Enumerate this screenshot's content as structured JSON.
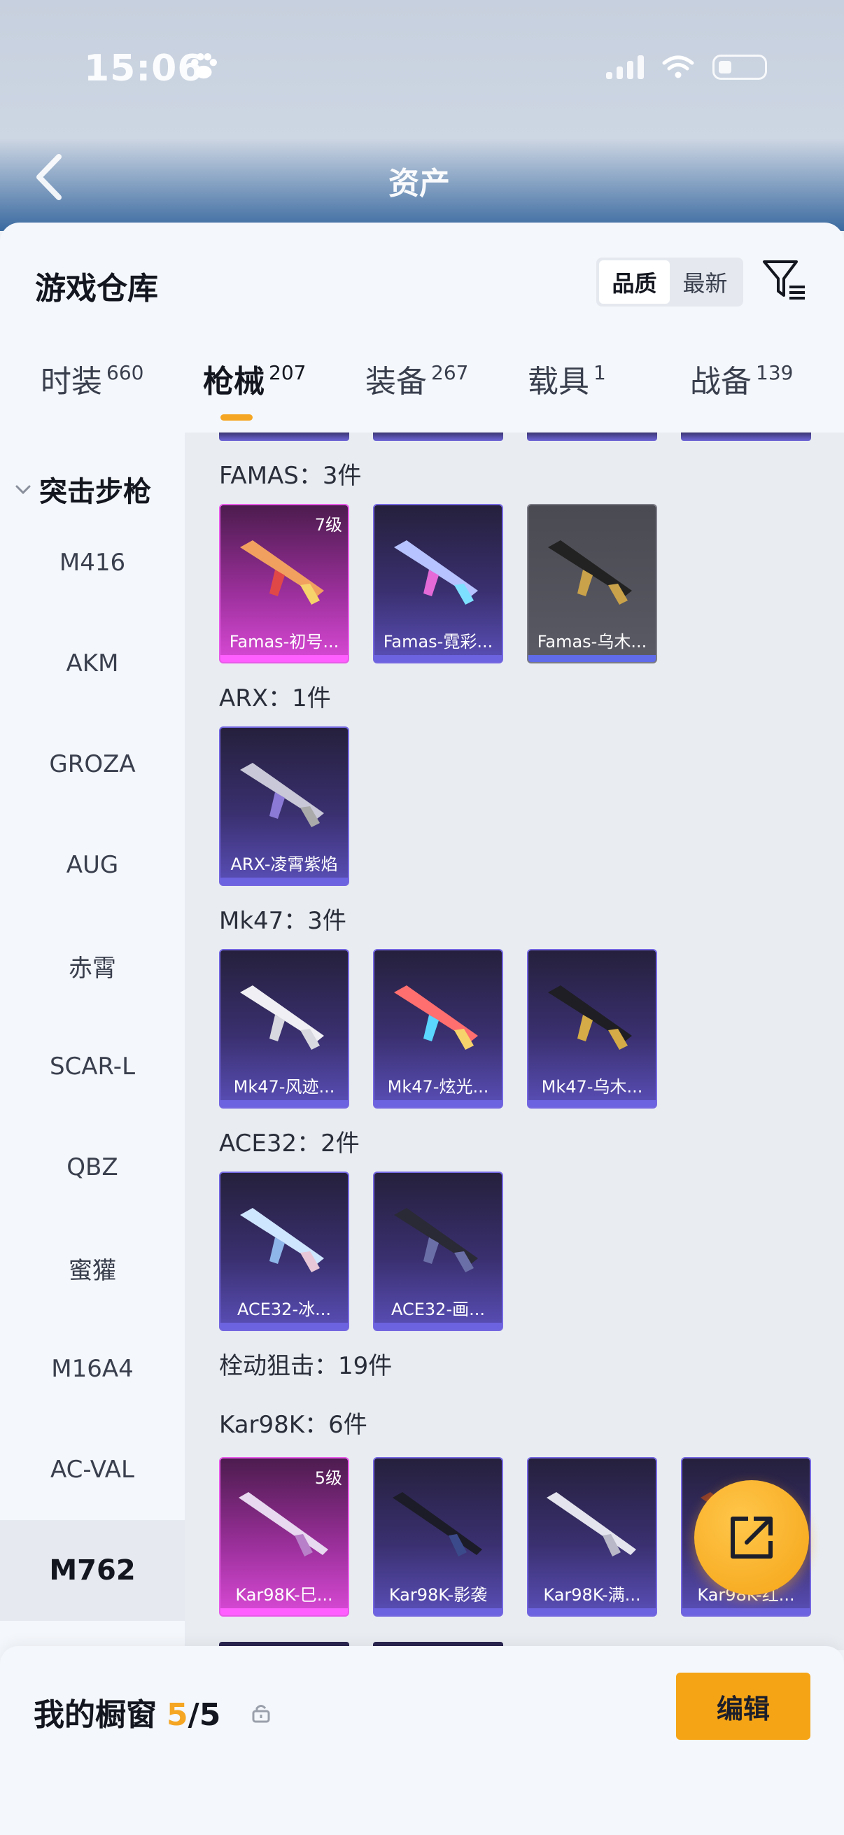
{
  "status_bar": {
    "time": "15:06"
  },
  "header": {
    "title": "资产"
  },
  "sheet": {
    "title": "游戏仓库",
    "sort": {
      "options": [
        "品质",
        "最新"
      ],
      "active": "品质"
    }
  },
  "tabs": [
    {
      "label": "时装",
      "count": "660"
    },
    {
      "label": "枪械",
      "count": "207"
    },
    {
      "label": "装备",
      "count": "267"
    },
    {
      "label": "载具",
      "count": "1"
    },
    {
      "label": "战备",
      "count": "139"
    }
  ],
  "sidebar": {
    "section": "突击步枪",
    "items": [
      "M416",
      "AKM",
      "GROZA",
      "AUG",
      "赤霄",
      "SCAR-L",
      "QBZ",
      "蜜獾",
      "M16A4",
      "AC-VAL",
      "M762"
    ],
    "active": "M762"
  },
  "groups": [
    {
      "title": "FAMAS：3件",
      "items": [
        {
          "name": "Famas-初号...",
          "level": "7级",
          "rarity": "purple"
        },
        {
          "name": "Famas-霓彩...",
          "rarity": "blue"
        },
        {
          "name": "Famas-乌木...",
          "rarity": "grey"
        }
      ]
    },
    {
      "title": "ARX：1件",
      "items": [
        {
          "name": "ARX-凌霄紫焰",
          "rarity": "blue"
        }
      ]
    },
    {
      "title": "Mk47：3件",
      "items": [
        {
          "name": "Mk47-风迹...",
          "rarity": "blue"
        },
        {
          "name": "Mk47-炫光...",
          "rarity": "blue"
        },
        {
          "name": "Mk47-乌木...",
          "rarity": "blue"
        }
      ]
    },
    {
      "title": "ACE32：2件",
      "items": [
        {
          "name": "ACE32-冰...",
          "rarity": "blue"
        },
        {
          "name": "ACE32-画...",
          "rarity": "blue"
        }
      ]
    },
    {
      "title": "栓动狙击：19件",
      "items": []
    },
    {
      "title": "Kar98K：6件",
      "items": [
        {
          "name": "Kar98K-巳...",
          "level": "5级",
          "rarity": "purple"
        },
        {
          "name": "Kar98K-影袭",
          "rarity": "blue"
        },
        {
          "name": "Kar98K-满...",
          "rarity": "blue"
        },
        {
          "name": "Kar98K-红...",
          "rarity": "blue"
        }
      ]
    }
  ],
  "footer": {
    "title": "我的橱窗",
    "current": "5",
    "total": "/5",
    "edit_label": "编辑"
  },
  "colors": {
    "accent": "#f5a416",
    "purple_rarity": "#d94ad6",
    "blue_rarity": "#6c63e0"
  }
}
